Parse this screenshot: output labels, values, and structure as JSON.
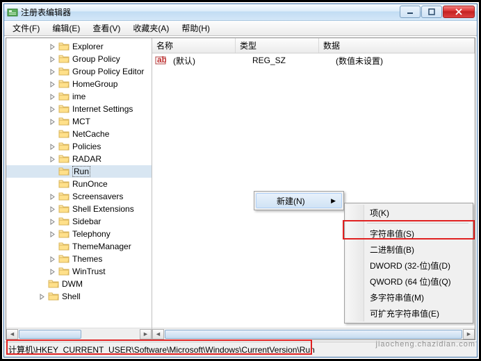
{
  "window": {
    "title": "注册表编辑器"
  },
  "menubar": {
    "file": "文件(F)",
    "edit": "编辑(E)",
    "view": "查看(V)",
    "favorites": "收藏夹(A)",
    "help": "帮助(H)"
  },
  "tree": {
    "items": [
      {
        "label": "Explorer",
        "exp": "right"
      },
      {
        "label": "Group Policy",
        "exp": "right"
      },
      {
        "label": "Group Policy Editor",
        "exp": "right"
      },
      {
        "label": "HomeGroup",
        "exp": "right"
      },
      {
        "label": "ime",
        "exp": "right"
      },
      {
        "label": "Internet Settings",
        "exp": "right"
      },
      {
        "label": "MCT",
        "exp": "right"
      },
      {
        "label": "NetCache",
        "exp": "none"
      },
      {
        "label": "Policies",
        "exp": "right"
      },
      {
        "label": "RADAR",
        "exp": "right"
      },
      {
        "label": "Run",
        "exp": "none",
        "selected": true
      },
      {
        "label": "RunOnce",
        "exp": "none"
      },
      {
        "label": "Screensavers",
        "exp": "right"
      },
      {
        "label": "Shell Extensions",
        "exp": "right"
      },
      {
        "label": "Sidebar",
        "exp": "right"
      },
      {
        "label": "Telephony",
        "exp": "right"
      },
      {
        "label": "ThemeManager",
        "exp": "none"
      },
      {
        "label": "Themes",
        "exp": "right"
      },
      {
        "label": "WinTrust",
        "exp": "right"
      }
    ],
    "tail": [
      {
        "label": "DWM",
        "exp": "none"
      },
      {
        "label": "Shell",
        "exp": "right"
      }
    ]
  },
  "list": {
    "columns": {
      "name": "名称",
      "type": "类型",
      "data": "数据"
    },
    "rows": [
      {
        "name": "(默认)",
        "type": "REG_SZ",
        "data": "(数值未设置)"
      }
    ]
  },
  "context_sub": {
    "new": "新建(N)"
  },
  "context_menu": {
    "key": "项(K)",
    "string": "字符串值(S)",
    "binary": "二进制值(B)",
    "dword": "DWORD (32-位)值(D)",
    "qword": "QWORD (64 位)值(Q)",
    "multi": "多字符串值(M)",
    "expand": "可扩充字符串值(E)"
  },
  "statusbar": {
    "path": "计算机\\HKEY_CURRENT_USER\\Software\\Microsoft\\Windows\\CurrentVersion\\Run"
  },
  "watermark": "jiaocheng.chazidian.com"
}
